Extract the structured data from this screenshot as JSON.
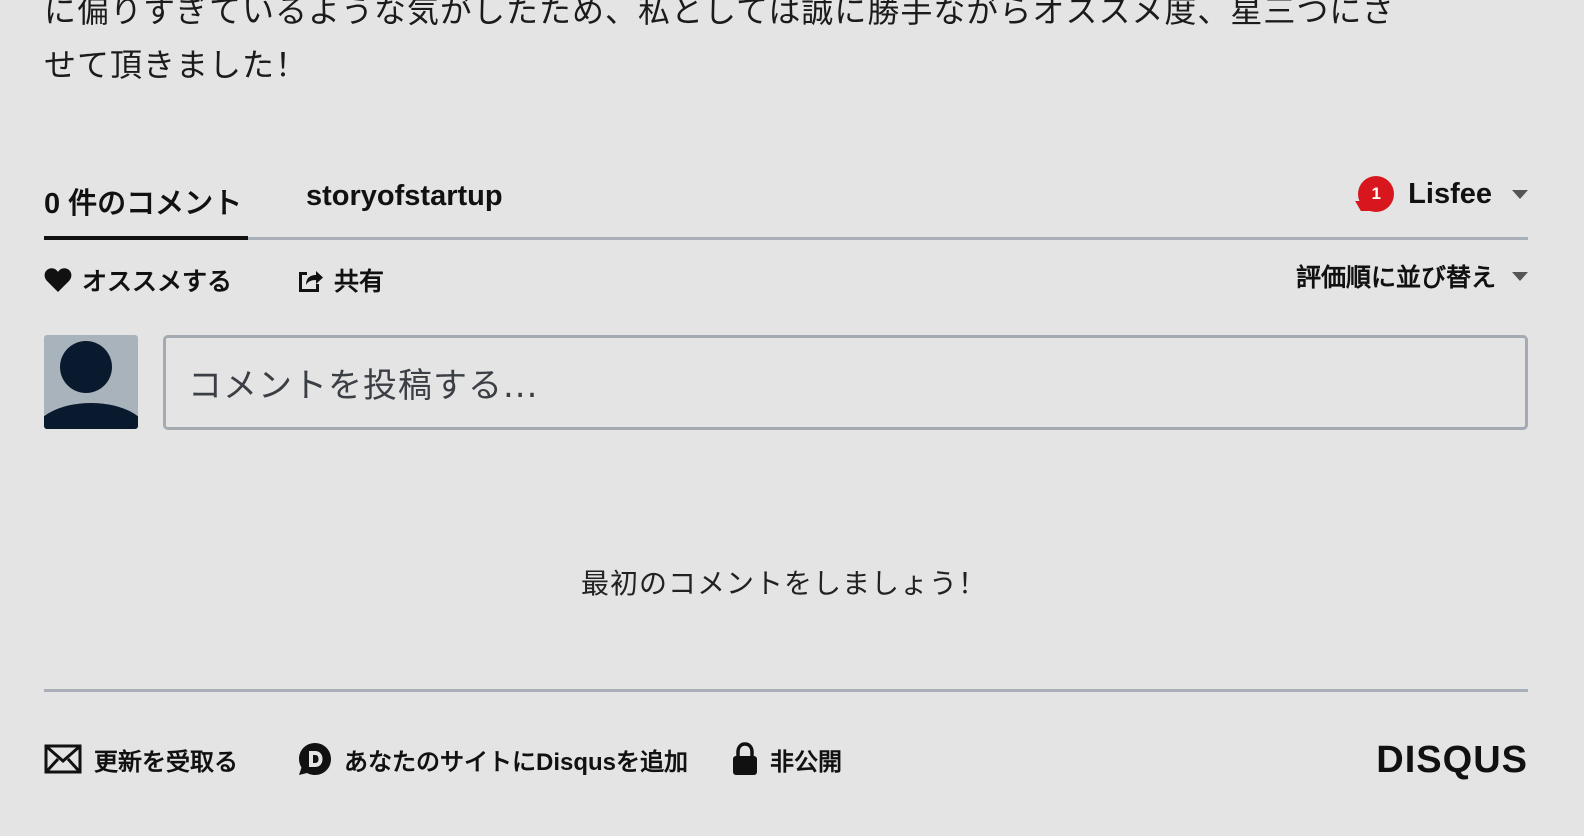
{
  "article": {
    "line1": "に偏りすぎているような気がしたため、私としては誠に勝手ながらオススメ度、星三つにさ",
    "line2": "せて頂きました！"
  },
  "nav": {
    "comments_tab": "0 件のコメント",
    "site_tab": "storyofstartup",
    "notification_count": "1",
    "username": "Lisfee"
  },
  "toolbar": {
    "recommend_label": "オススメする",
    "share_label": "共有",
    "sort_label": "評価順に並び替え"
  },
  "composer": {
    "placeholder": "コメントを投稿する..."
  },
  "empty_message": "最初のコメントをしましょう！",
  "footer": {
    "subscribe_label": "更新を受取る",
    "add_disqus_label": "あなたのサイトにDisqusを追加",
    "privacy_label": "非公開",
    "brand": "DISQUS"
  },
  "colors": {
    "background": "#e4e4e4",
    "badge": "#d7171d",
    "divider": "#a9afb8",
    "avatar_bg": "#a9b3bb",
    "avatar_fg": "#0a1a2e"
  },
  "icons": {
    "recommend": "heart-icon",
    "share": "share-icon",
    "subscribe": "envelope-icon",
    "add_disqus": "disqus-logo-icon",
    "privacy": "lock-icon"
  }
}
